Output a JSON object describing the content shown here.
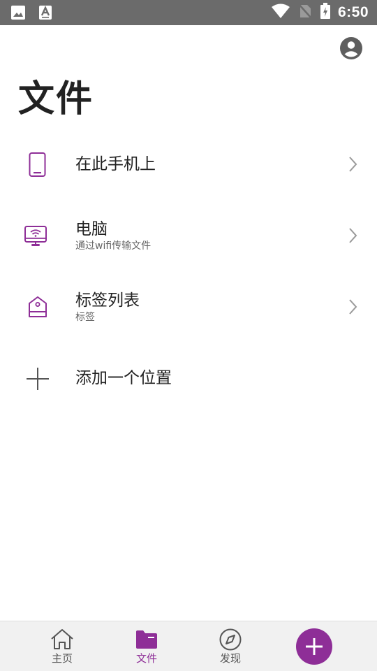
{
  "status_bar": {
    "time": "6:50",
    "left_icons": [
      "image-icon",
      "text-format-icon"
    ],
    "right_icons": [
      "wifi-icon",
      "no-sim-icon",
      "battery-charging-icon"
    ]
  },
  "header": {
    "title": "文件",
    "account_icon": "account-circle-icon"
  },
  "locations": [
    {
      "title": "在此手机上",
      "subtitle": "",
      "icon": "phone-icon"
    },
    {
      "title": "电脑",
      "subtitle": "通过wifi传输文件",
      "icon": "computer-wifi-icon"
    },
    {
      "title": "标签列表",
      "subtitle": "标签",
      "icon": "tag-icon"
    },
    {
      "title": "添加一个位置",
      "subtitle": "",
      "icon": "plus-icon"
    }
  ],
  "bottom_nav": {
    "items": [
      {
        "label": "主页",
        "icon": "home-icon",
        "active": false
      },
      {
        "label": "文件",
        "icon": "folder-icon",
        "active": true
      },
      {
        "label": "发现",
        "icon": "compass-icon",
        "active": false
      }
    ],
    "fab_icon": "plus-icon"
  },
  "colors": {
    "accent": "#8e2e97",
    "status_bar": "#6b6b6b",
    "nav_background": "#f1f1f1"
  }
}
